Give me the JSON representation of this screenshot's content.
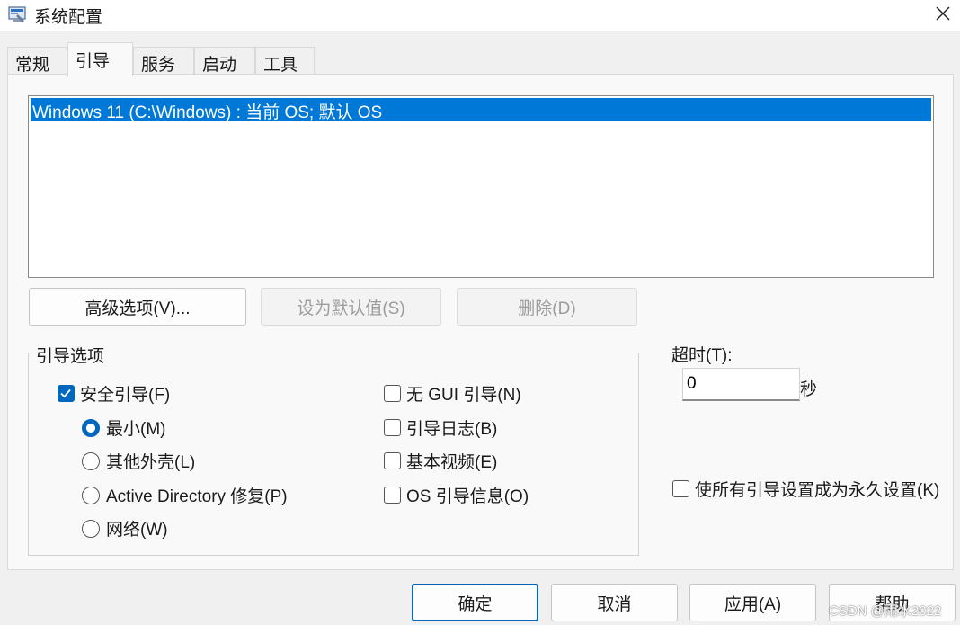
{
  "window": {
    "title": "系统配置",
    "close_glyph": "✕"
  },
  "tabs": [
    {
      "label": "常规",
      "active": false
    },
    {
      "label": "引导",
      "active": true
    },
    {
      "label": "服务",
      "active": false
    },
    {
      "label": "启动",
      "active": false
    },
    {
      "label": "工具",
      "active": false
    }
  ],
  "os_list": {
    "items": [
      {
        "label": "Windows 11 (C:\\Windows) : 当前 OS; 默认 OS",
        "selected": true
      }
    ]
  },
  "actions": {
    "advanced_label": "高级选项(V)...",
    "set_default_label": "设为默认值(S)",
    "delete_label": "删除(D)"
  },
  "boot_options": {
    "legend": "引导选项",
    "safe_boot": {
      "label": "安全引导(F)",
      "checked": true
    },
    "radios": [
      {
        "label": "最小(M)",
        "checked": true
      },
      {
        "label": "其他外壳(L)",
        "checked": false
      },
      {
        "label": "Active Directory 修复(P)",
        "checked": false
      },
      {
        "label": "网络(W)",
        "checked": false
      }
    ],
    "checkboxes": [
      {
        "label": "无 GUI 引导(N)",
        "checked": false
      },
      {
        "label": "引导日志(B)",
        "checked": false
      },
      {
        "label": "基本视频(E)",
        "checked": false
      },
      {
        "label": "OS 引导信息(O)",
        "checked": false
      }
    ]
  },
  "timeout": {
    "label": "超时(T):",
    "value": "0",
    "unit": "秒"
  },
  "permanent": {
    "label": "使所有引导设置成为永久设置(K)",
    "checked": false
  },
  "footer": {
    "ok_label": "确定",
    "cancel_label": "取消",
    "apply_label": "应用(A)",
    "help_label": "帮助"
  },
  "watermark": "CSDN @雨水2022",
  "colors": {
    "selection": "#0078d7",
    "accent": "#0067c0"
  }
}
